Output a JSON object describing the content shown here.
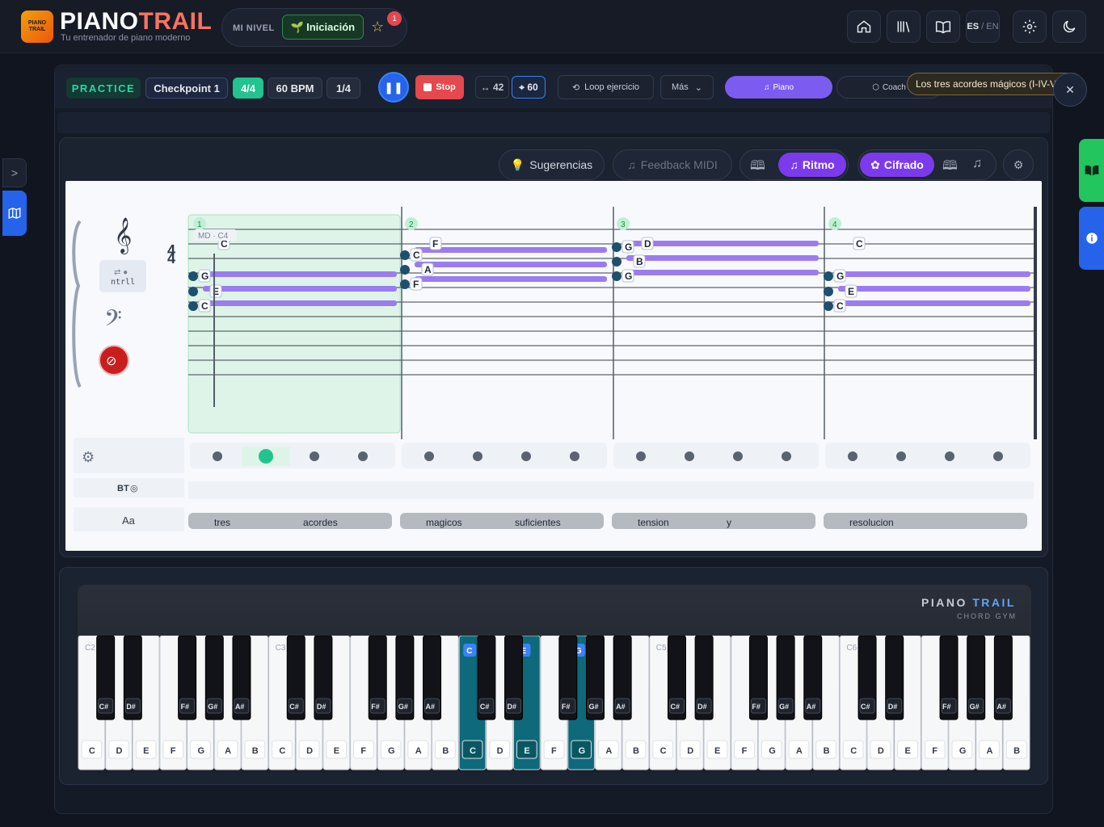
{
  "header": {
    "logo_mark": "PIANO TRAIL",
    "title_main": "PIANO",
    "title_accent": "TRAIL",
    "subtitle": "Tu entrenador de piano moderno",
    "level_label": "MI NIVEL",
    "level_value": "Iniciación",
    "level_badge": "1",
    "lang_active": "ES",
    "lang_other": "EN"
  },
  "toolbar": {
    "practice": "PRACTICE",
    "checkpoint": "Checkpoint 1",
    "time_signature": "4/4",
    "bpm": "60 BPM",
    "subdivision": "1/4",
    "stop": "Stop",
    "range_value": "42",
    "target_value": "60",
    "loop": "Loop ejercicio",
    "more": "Más",
    "piano": "Piano",
    "coach": "Coach",
    "tooltip": "Los tres acordes mágicos (I-IV-V)"
  },
  "score_toolbar": {
    "suggestions": "Sugerencias",
    "midi_feedback": "Feedback MIDI",
    "rhythm": "Ritmo",
    "chords": "Cifrado"
  },
  "score": {
    "time_sig_top": "4",
    "time_sig_bottom": "4",
    "hand_label": "MD · C4",
    "ctrl_label": "ntrll",
    "bt_label": "BT",
    "aa_label": "Aa",
    "measures": [
      {
        "number": "1",
        "notes": [
          "C",
          "G",
          "E",
          "C"
        ]
      },
      {
        "number": "2",
        "notes": [
          "F",
          "C",
          "A",
          "F"
        ]
      },
      {
        "number": "3",
        "notes": [
          "D",
          "G",
          "B",
          "G"
        ]
      },
      {
        "number": "4",
        "notes": [
          "C",
          "G",
          "E",
          "C"
        ]
      }
    ],
    "lyrics": [
      [
        "tres",
        "acordes"
      ],
      [
        "magicos",
        "suficientes"
      ],
      [
        "tension",
        "y"
      ],
      [
        "resolucion"
      ]
    ]
  },
  "piano": {
    "brand_main": "PIANO",
    "brand_accent": "TRAIL",
    "brand_sub": "CHORD GYM",
    "octave_labels": [
      "C2",
      "C3",
      "C4",
      "C5",
      "C6"
    ],
    "white_keys": [
      "C",
      "D",
      "E",
      "F",
      "G",
      "A",
      "B"
    ],
    "black_keys": [
      "C#",
      "D#",
      "F#",
      "G#",
      "A#"
    ],
    "highlighted": [
      "C",
      "E",
      "G"
    ]
  },
  "colors": {
    "accent_green": "#22c38e",
    "accent_purple": "#7c3aed",
    "accent_blue": "#2563eb",
    "stop_red": "#e5484d",
    "highlight_key": "#0e6a7a"
  }
}
